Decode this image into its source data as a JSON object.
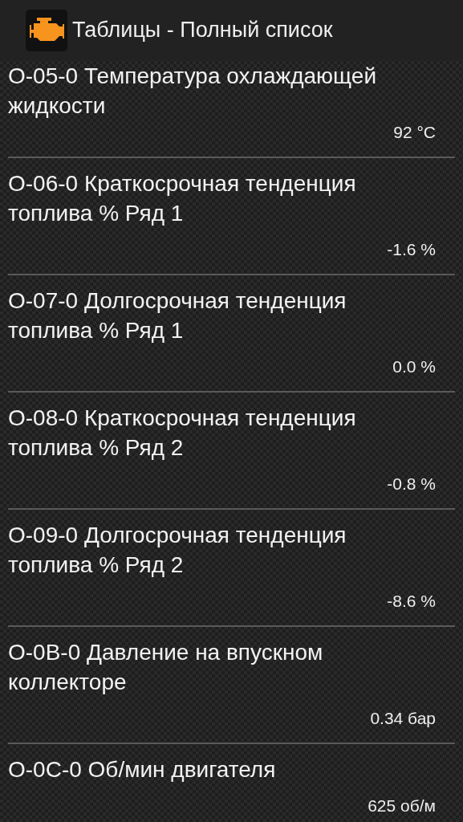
{
  "app_bar": {
    "title": "Таблицы - Полный список"
  },
  "items": [
    {
      "title": "O-05-0 Температура охлаждающей жидкости",
      "value": "92 °C"
    },
    {
      "title": "O-06-0 Краткосрочная тенденция топлива % Ряд 1",
      "value": "-1.6 %"
    },
    {
      "title": "O-07-0 Долгосрочная тенденция топлива % Ряд 1",
      "value": "0.0 %"
    },
    {
      "title": "O-08-0 Краткосрочная тенденция топлива % Ряд 2",
      "value": "-0.8 %"
    },
    {
      "title": "O-09-0 Долгосрочная тенденция топлива % Ряд 2",
      "value": "-8.6 %"
    },
    {
      "title": "O-0B-0 Давление на впускном коллекторе",
      "value": "0.34 бар"
    },
    {
      "title": "O-0C-0 Об/мин двигателя",
      "value": "625 об/м"
    }
  ]
}
